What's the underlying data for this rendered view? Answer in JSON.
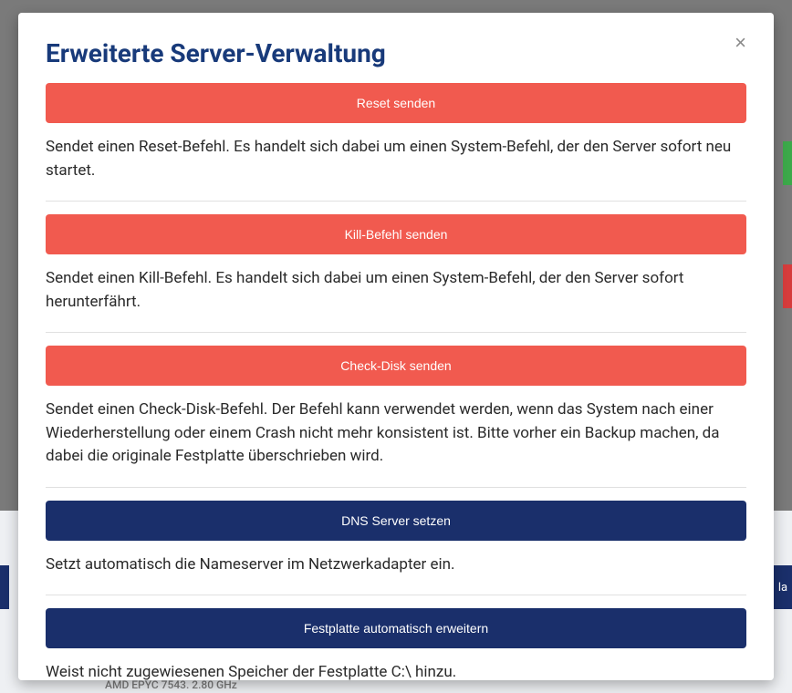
{
  "modal": {
    "title": "Erweiterte Server-Verwaltung",
    "actions": [
      {
        "button_label": "Reset senden",
        "button_style": "danger",
        "description": "Sendet einen Reset-Befehl. Es handelt sich dabei um einen System-Befehl, der den Server sofort neu startet."
      },
      {
        "button_label": "Kill-Befehl senden",
        "button_style": "danger",
        "description": "Sendet einen Kill-Befehl. Es handelt sich dabei um einen System-Befehl, der den Server sofort herunterfährt."
      },
      {
        "button_label": "Check-Disk senden",
        "button_style": "danger",
        "description": "Sendet einen Check-Disk-Befehl. Der Befehl kann verwendet werden, wenn das System nach einer Wiederherstellung oder einem Crash nicht mehr konsistent ist. Bitte vorher ein Backup machen, da dabei die originale Festplatte überschrieben wird."
      },
      {
        "button_label": "DNS Server setzen",
        "button_style": "primary",
        "description": "Setzt automatisch die Nameserver im Netzwerkadapter ein."
      },
      {
        "button_label": "Festplatte automatisch erweitern",
        "button_style": "primary",
        "description": "Weist nicht zugewiesenen Speicher der Festplatte C:\\ hinzu."
      }
    ]
  },
  "backdrop": {
    "cpu_text": "AMD EPYC 7543. 2.80 GHz",
    "right_edge_label": "la"
  }
}
